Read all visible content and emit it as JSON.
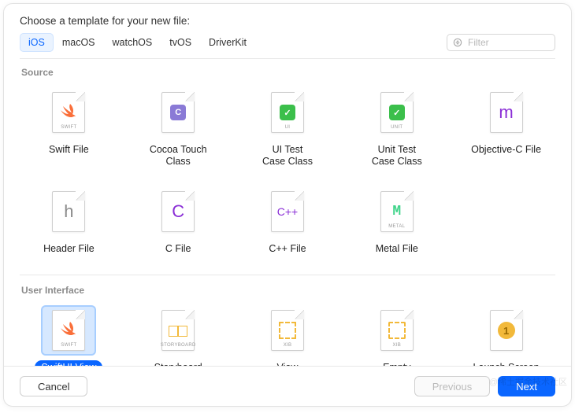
{
  "title": "Choose a template for your new file:",
  "platforms": [
    "iOS",
    "macOS",
    "watchOS",
    "tvOS",
    "DriverKit"
  ],
  "active_platform_index": 0,
  "filter": {
    "placeholder": "Filter",
    "value": ""
  },
  "sections": {
    "source": {
      "label": "Source",
      "items": [
        {
          "name": "Swift File",
          "glyph_kind": "swift",
          "tag": "SWIFT"
        },
        {
          "name": "Cocoa Touch\nClass",
          "glyph_kind": "square",
          "glyph": "C",
          "bg": "#8a7ad6",
          "tag": ""
        },
        {
          "name": "UI Test\nCase Class",
          "glyph_kind": "square",
          "glyph": "✓",
          "bg": "#3bbf4b",
          "tag": "UI"
        },
        {
          "name": "Unit Test\nCase Class",
          "glyph_kind": "square",
          "glyph": "✓",
          "bg": "#3bbf4b",
          "tag": "UNIT"
        },
        {
          "name": "Objective-C File",
          "glyph_kind": "text",
          "glyph": "m",
          "color": "#8a2ed6",
          "tag": ""
        },
        {
          "name": "Header File",
          "glyph_kind": "text",
          "glyph": "h",
          "color": "#8a8a8a",
          "tag": ""
        },
        {
          "name": "C File",
          "glyph_kind": "text",
          "glyph": "C",
          "color": "#8a2ed6",
          "tag": ""
        },
        {
          "name": "C++ File",
          "glyph_kind": "text",
          "glyph": "C++",
          "color": "#8a2ed6",
          "size": "14",
          "tag": ""
        },
        {
          "name": "Metal File",
          "glyph_kind": "metal",
          "tag": "METAL"
        }
      ]
    },
    "ui": {
      "label": "User Interface",
      "items": [
        {
          "name": "SwiftUI View",
          "glyph_kind": "swift",
          "tag": "SWIFT",
          "selected": true
        },
        {
          "name": "Storyboard",
          "glyph_kind": "storyboard",
          "tag": "STORYBOARD"
        },
        {
          "name": "View",
          "glyph_kind": "viewrect",
          "tag": "XIB"
        },
        {
          "name": "Empty",
          "glyph_kind": "emptyrect",
          "tag": "XIB"
        },
        {
          "name": "Launch Screen",
          "glyph_kind": "circle1",
          "tag": ""
        }
      ]
    }
  },
  "buttons": {
    "cancel": "Cancel",
    "previous": "Previous",
    "next": "Next"
  },
  "watermark": "@稀土掘金技术社区"
}
